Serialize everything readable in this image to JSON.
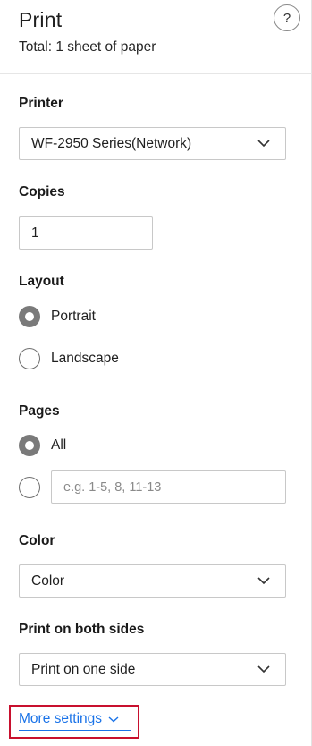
{
  "header": {
    "title": "Print",
    "subtitle": "Total: 1 sheet of paper",
    "help_label": "?"
  },
  "printer": {
    "label": "Printer",
    "value": "WF-2950 Series(Network)"
  },
  "copies": {
    "label": "Copies",
    "value": "1"
  },
  "layout": {
    "label": "Layout",
    "options": [
      {
        "label": "Portrait",
        "checked": true
      },
      {
        "label": "Landscape",
        "checked": false
      }
    ]
  },
  "pages": {
    "label": "Pages",
    "all_label": "All",
    "custom_placeholder": "e.g. 1-5, 8, 11-13"
  },
  "color": {
    "label": "Color",
    "value": "Color"
  },
  "duplex": {
    "label": "Print on both sides",
    "value": "Print on one side"
  },
  "more_settings": {
    "label": "More settings"
  },
  "colors": {
    "accent_link": "#1a73e8",
    "highlight_box": "#c8102e",
    "radio_checked": "#7a7a7a"
  }
}
